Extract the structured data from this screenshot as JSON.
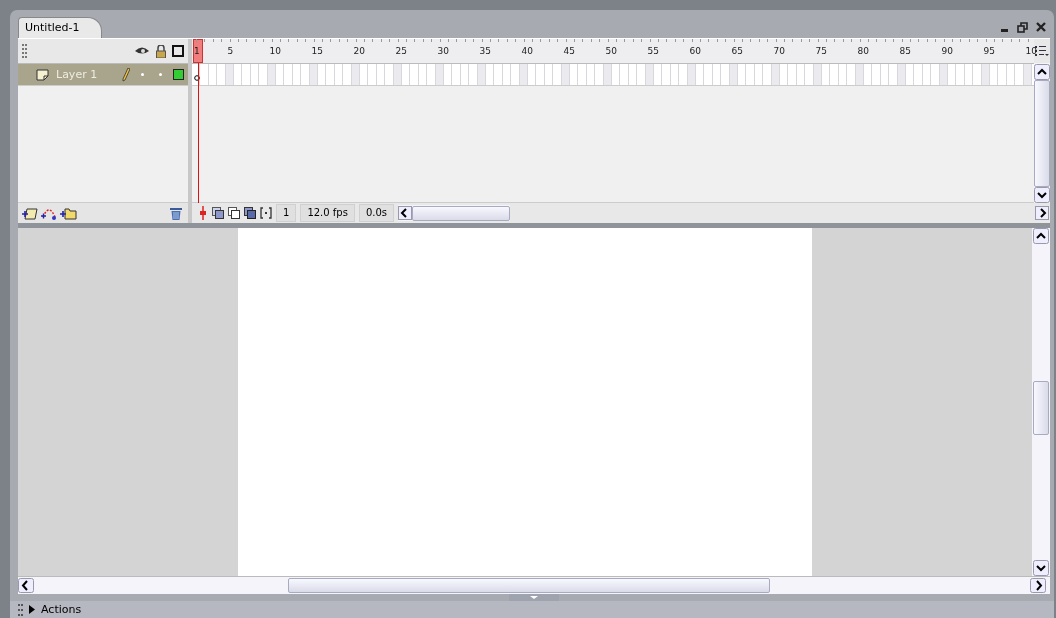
{
  "document_tab": {
    "title": "Untitled-1"
  },
  "timeline": {
    "ruler_labels": [
      "1",
      "5",
      "10",
      "15",
      "20",
      "25",
      "30",
      "35",
      "40",
      "45",
      "50",
      "55",
      "60",
      "65",
      "70",
      "75",
      "80",
      "85",
      "90",
      "95",
      "10"
    ],
    "layers": [
      {
        "name": "Layer 1",
        "selected": true,
        "color": "#33cc33"
      }
    ],
    "current_frame": "1",
    "frame_rate": "12.0 fps",
    "elapsed_time": "0.0s"
  },
  "actions_panel": {
    "title": "Actions",
    "expanded": false
  }
}
